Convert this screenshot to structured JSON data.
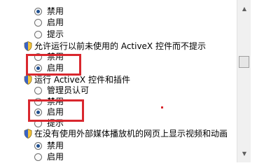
{
  "settings": {
    "group1": {
      "options": [
        {
          "label": "禁用",
          "selected": true
        },
        {
          "label": "启用",
          "selected": false
        },
        {
          "label": "提示",
          "selected": false
        }
      ]
    },
    "group2": {
      "title": "允许运行以前未使用的 ActiveX 控件而不提示",
      "options": [
        {
          "label": "禁用",
          "selected": false
        },
        {
          "label": "启用",
          "selected": true
        }
      ]
    },
    "group3": {
      "title": "运行 ActiveX 控件和插件",
      "options": [
        {
          "label": "管理员认可",
          "selected": false
        },
        {
          "label": "禁用",
          "selected": false
        },
        {
          "label": "启用",
          "selected": true
        },
        {
          "label": "提示",
          "selected": false
        }
      ]
    },
    "group4": {
      "title": "在没有使用外部媒体播放机的网页上显示视频和动画",
      "options": [
        {
          "label": "禁用",
          "selected": true
        },
        {
          "label": "启用",
          "selected": false
        }
      ]
    }
  },
  "scrollbar": {
    "up_icon": "▲",
    "down_icon": "▼"
  },
  "colors": {
    "highlight": "#d9272e",
    "radio_dot": "#1f4f8f"
  }
}
